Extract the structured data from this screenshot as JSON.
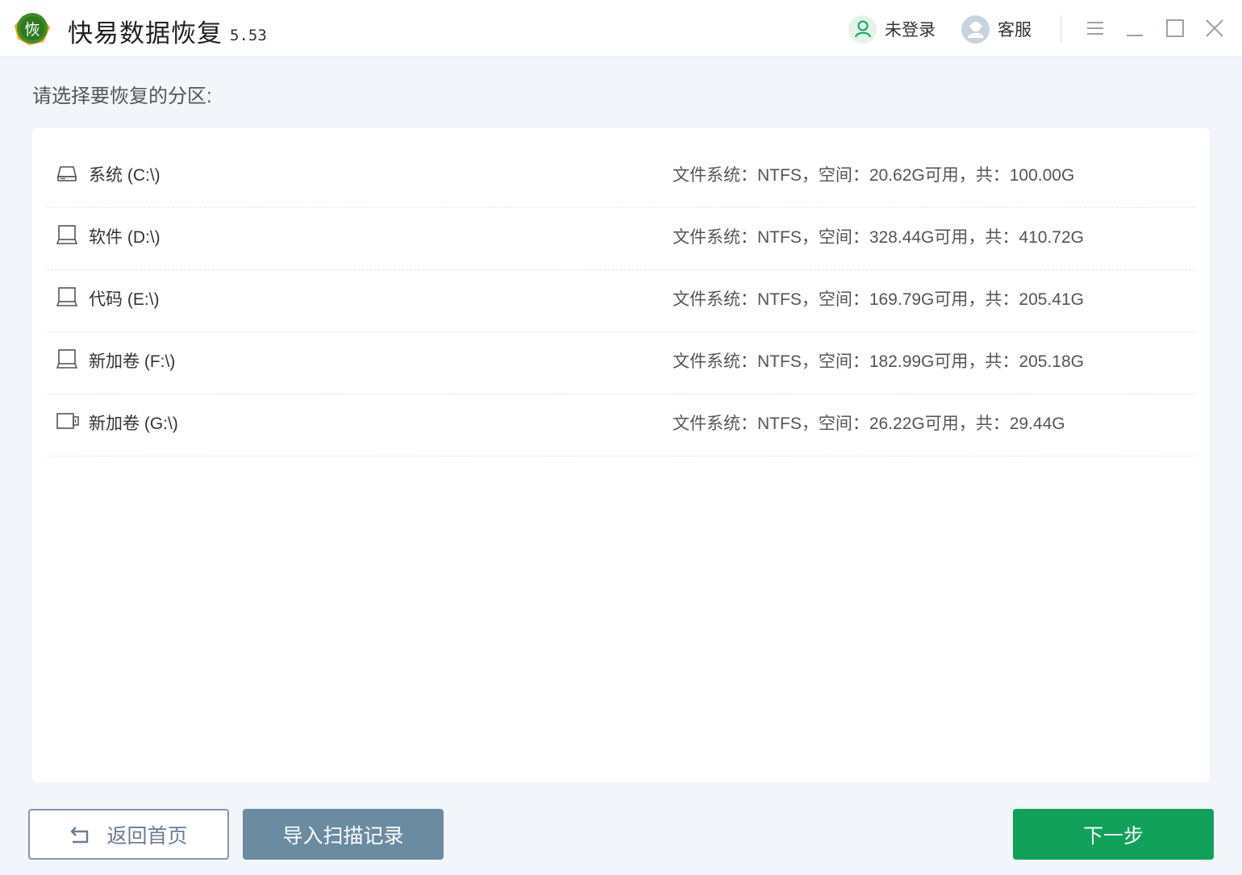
{
  "app": {
    "title": "快易数据恢复",
    "version": "5.53",
    "logo_char": "恢"
  },
  "header": {
    "account_label": "未登录",
    "support_label": "客服"
  },
  "prompt": "请选择要恢复的分区:",
  "partitions": [
    {
      "name": "系统 (C:\\)",
      "info": "文件系统：NTFS，空间：20.62G可用，共：100.00G",
      "icon": "system-drive-icon"
    },
    {
      "name": "软件 (D:\\)",
      "info": "文件系统：NTFS，空间：328.44G可用，共：410.72G",
      "icon": "drive-icon"
    },
    {
      "name": "代码 (E:\\)",
      "info": "文件系统：NTFS，空间：169.79G可用，共：205.41G",
      "icon": "drive-icon"
    },
    {
      "name": "新加卷 (F:\\)",
      "info": "文件系统：NTFS，空间：182.99G可用，共：205.18G",
      "icon": "drive-icon"
    },
    {
      "name": "新加卷 (G:\\)",
      "info": "文件系统：NTFS，空间：26.22G可用，共：29.44G",
      "icon": "usb-drive-icon"
    }
  ],
  "footer": {
    "back_label": "返回首页",
    "import_label": "导入扫描记录",
    "next_label": "下一步"
  },
  "colors": {
    "accent_green": "#11a15a",
    "import_button": "#6b8ba1",
    "background": "#f2f5fa"
  }
}
